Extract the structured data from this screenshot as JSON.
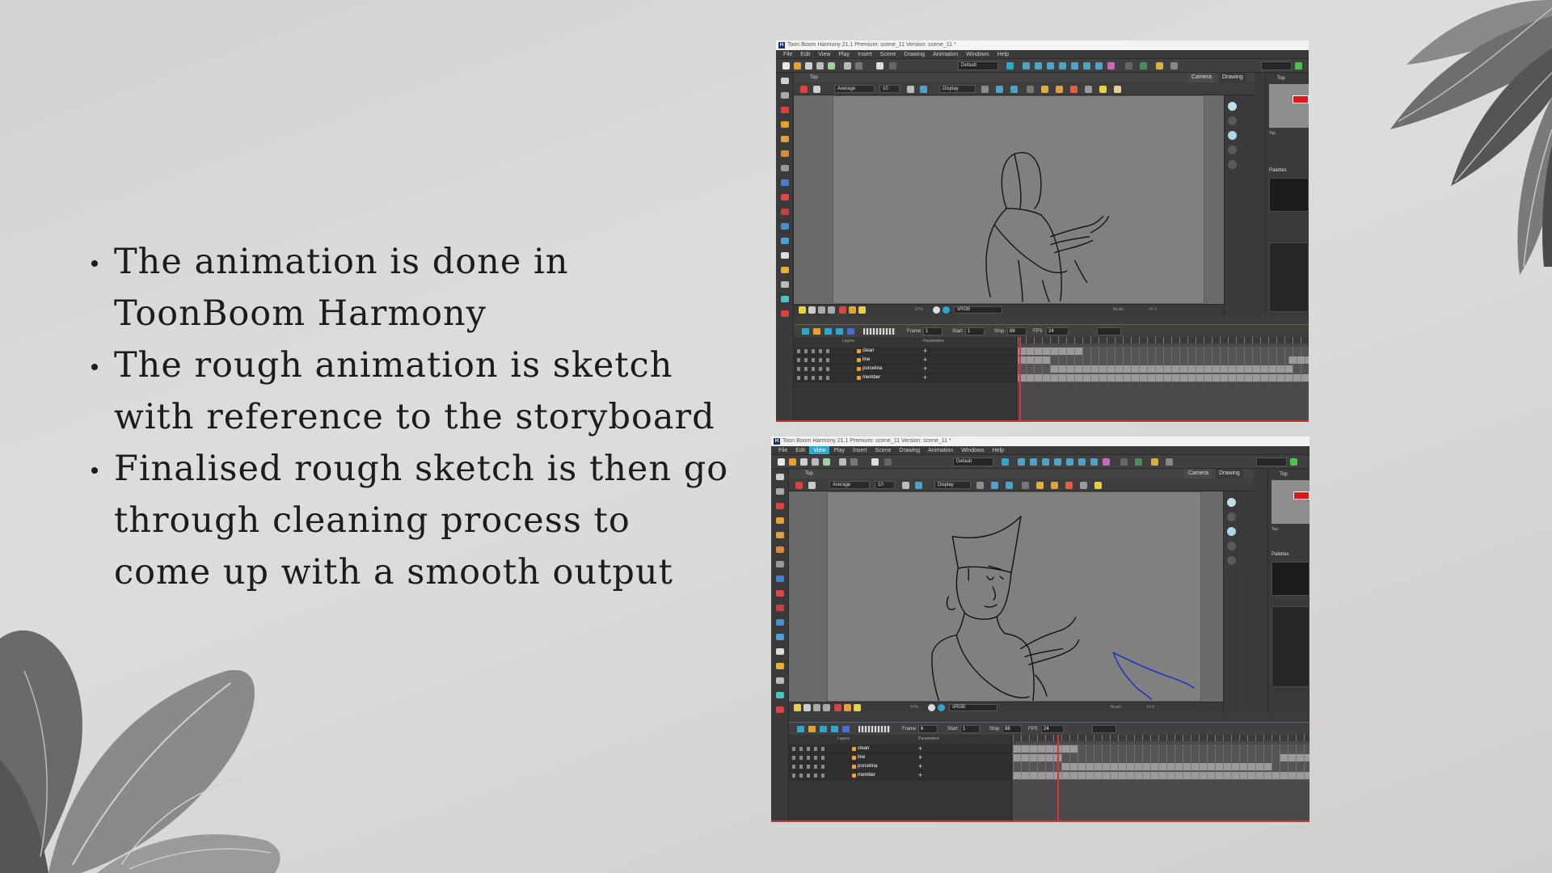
{
  "bullets": [
    "The animation is done in ToonBoom Harmony",
    "The rough animation is sketch with reference to the storyboard",
    "Finalised rough sketch is then go through cleaning process to come up with a smooth output"
  ],
  "apps": [
    {
      "title": "Toon Boom Harmony 21.1 Premium: scene_11 Version: scene_11 *",
      "menu": [
        "File",
        "Edit",
        "View",
        "Play",
        "Insert",
        "Scene",
        "Drawing",
        "Animation",
        "Windows",
        "Help"
      ],
      "active_menu": "",
      "workspace": "Default",
      "view_tab": "Top",
      "camera_tab": "Camera",
      "drawing_tab": "Drawing",
      "smoothing_mode": "Average",
      "smoothing_value": "10",
      "display_mode": "Display",
      "zoom": "57%",
      "color_space": "sRGB",
      "tool_name": "Brush",
      "frame_readout": "Fr 1",
      "side_view_tab": "Top",
      "side_top_label": "Top",
      "palettes_label": "Palettes",
      "frame_label": "Frame",
      "frame": "1",
      "start_label": "Start",
      "start": "1",
      "stop_label": "Stop",
      "stop": "88",
      "fps_label": "FPS",
      "fps": "24",
      "layers_label": "Layers",
      "parameters_label": "Parameters",
      "layers": [
        "clean",
        "line",
        "porcelina",
        "member"
      ]
    },
    {
      "title": "Toon Boom Harmony 21.1 Premium: scene_11 Version: scene_11 *",
      "menu": [
        "File",
        "Edit",
        "View",
        "Play",
        "Insert",
        "Scene",
        "Drawing",
        "Animation",
        "Windows",
        "Help"
      ],
      "active_menu": "View",
      "workspace": "Default",
      "view_tab": "Top",
      "camera_tab": "Camera",
      "drawing_tab": "Drawing",
      "smoothing_mode": "Average",
      "smoothing_value": "10",
      "display_mode": "Display",
      "zoom": "57%",
      "color_space": "sRGB",
      "tool_name": "Brush",
      "frame_readout": "Fr 6",
      "side_view_tab": "Top",
      "side_top_label": "Top",
      "palettes_label": "Palettes",
      "frame_label": "Frame",
      "frame": "6",
      "start_label": "Start",
      "start": "1",
      "stop_label": "Stop",
      "stop": "88",
      "fps_label": "FPS",
      "fps": "24",
      "layers_label": "Layers",
      "parameters_label": "Parameters",
      "layers": [
        "clean",
        "line",
        "porcelina",
        "member"
      ]
    }
  ],
  "colors": {
    "accent_cyan": "#2da8c9",
    "alert_red": "#e01515",
    "playhead_red": "#e13030",
    "sketch_blue": "#2030c0"
  }
}
